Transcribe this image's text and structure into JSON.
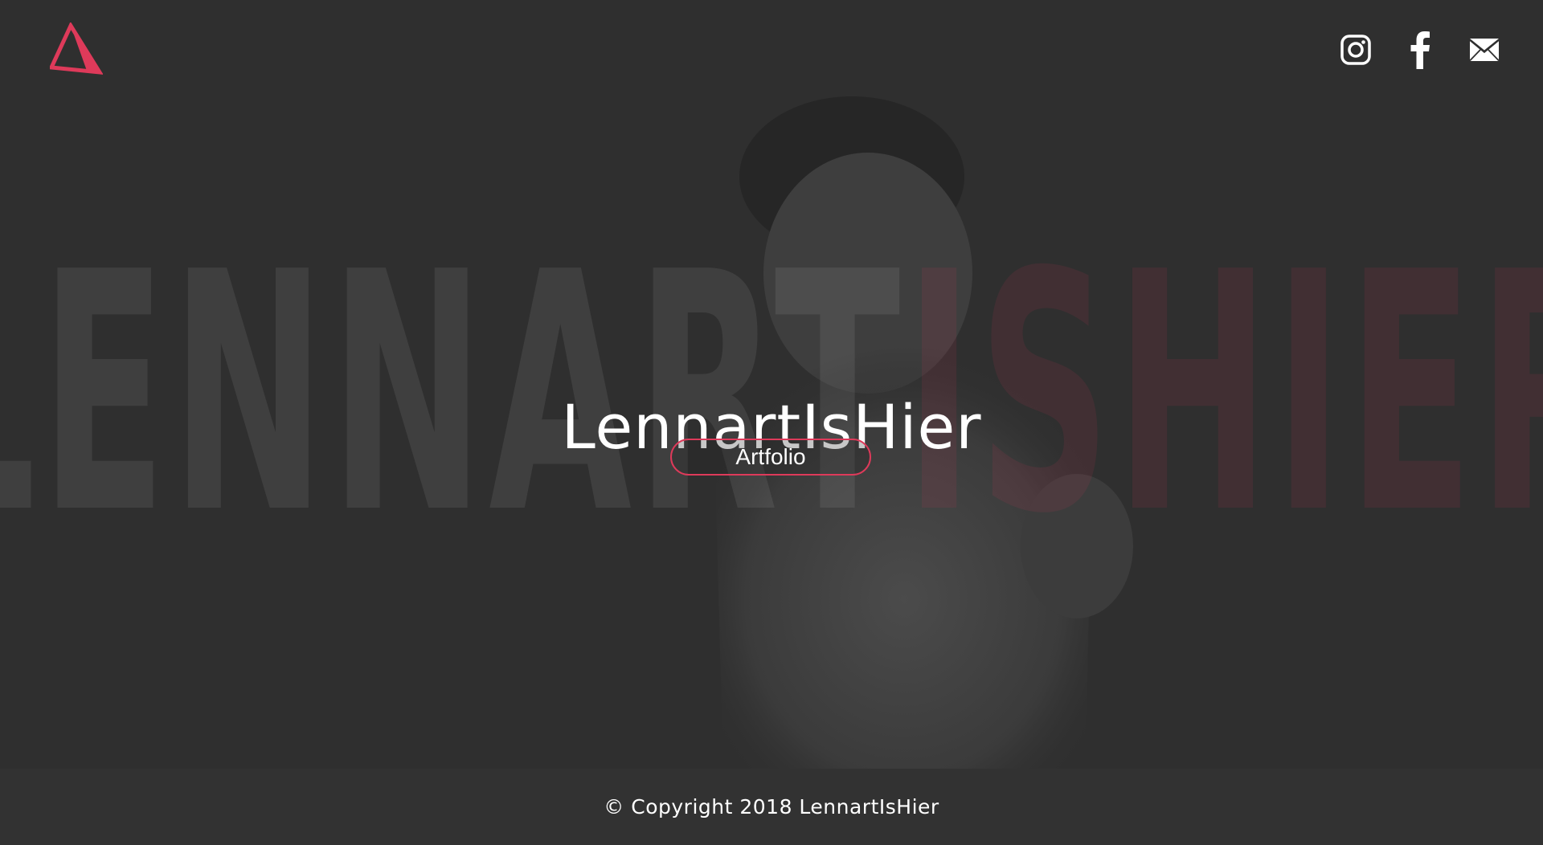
{
  "brand": {
    "logo_icon": "triangle-logo-icon",
    "accent_color": "#de3a5a"
  },
  "background_word": {
    "part1": "LENNART",
    "part2": "ISHIER"
  },
  "social": [
    {
      "icon": "instagram-icon"
    },
    {
      "icon": "facebook-icon"
    },
    {
      "icon": "mail-icon"
    }
  ],
  "hero": {
    "title": "LennartIsHier",
    "button_label": "Artfolio"
  },
  "footer": {
    "copyright": "© Copyright 2018 LennartIsHier"
  },
  "colors": {
    "background": "#2f2f2f",
    "footer": "#323232",
    "text": "#ffffff"
  }
}
